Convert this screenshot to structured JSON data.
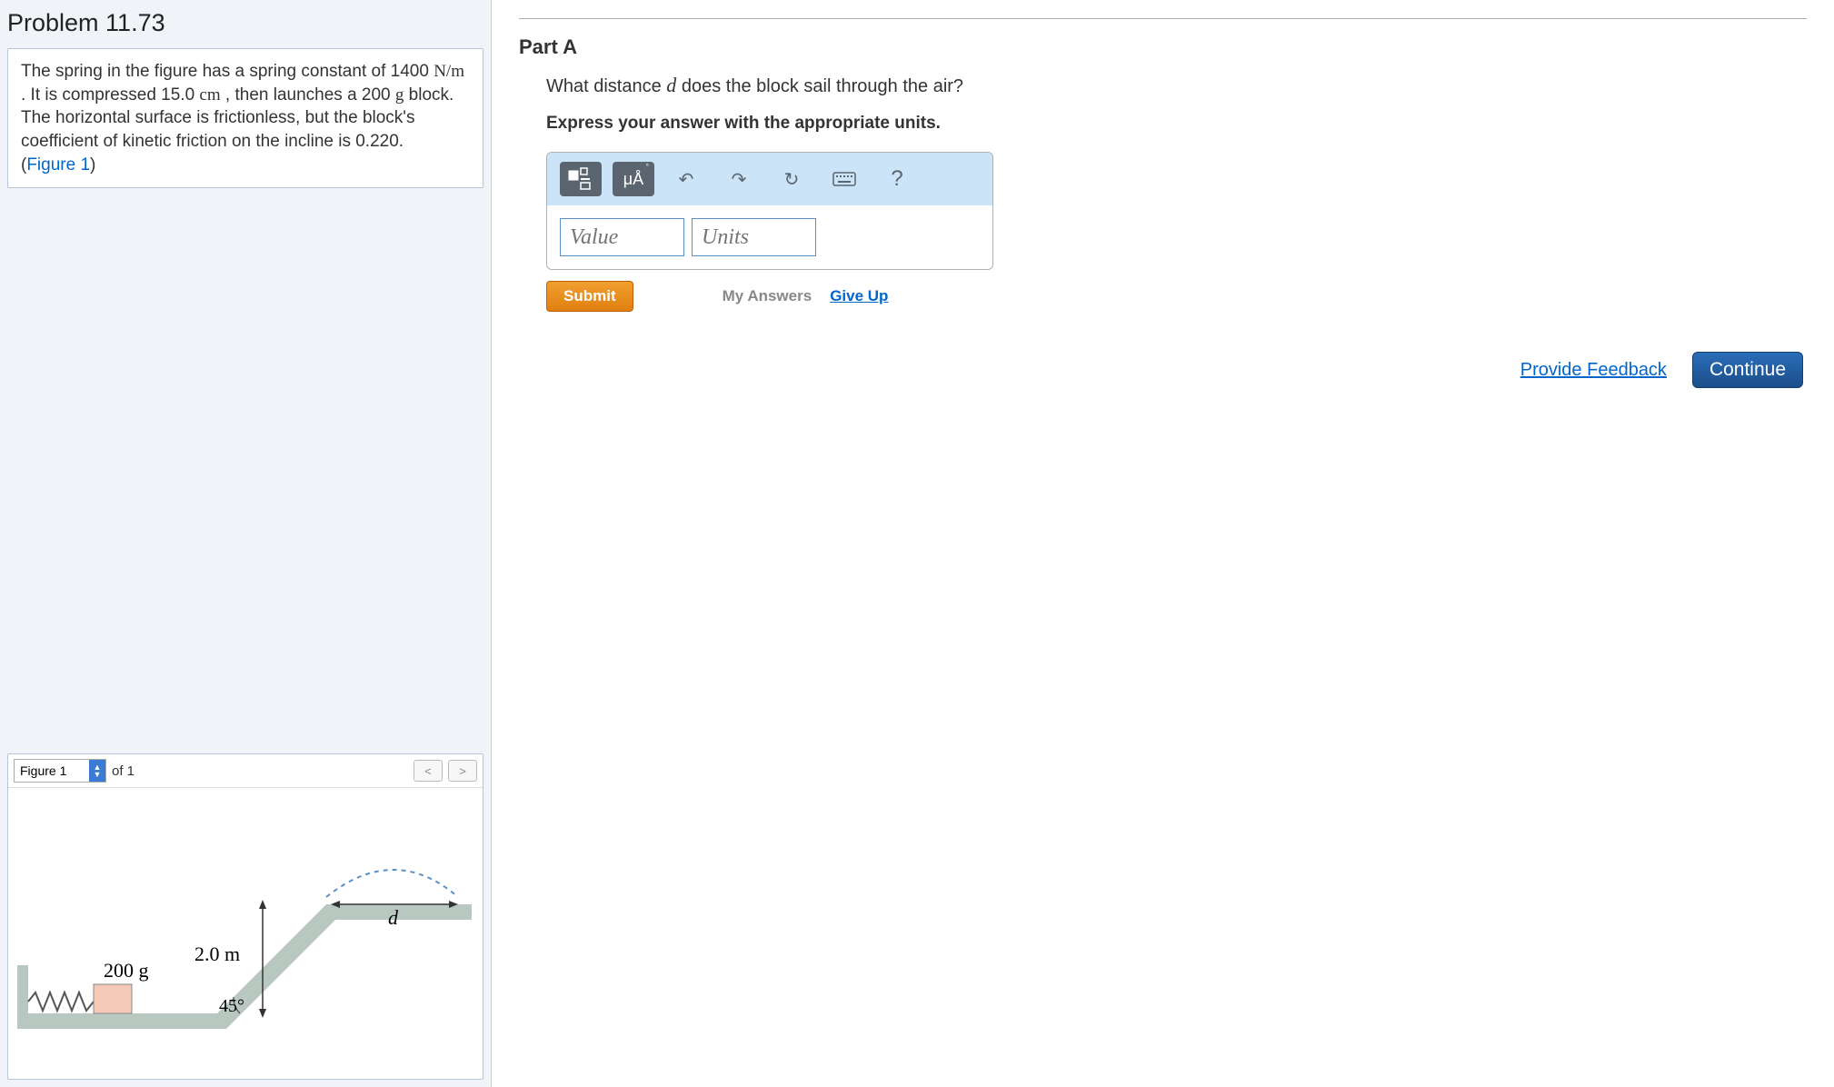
{
  "problem": {
    "title": "Problem 11.73",
    "text_1": "The spring in the figure has a spring constant of 1400 ",
    "unit_nm": "N/m",
    "text_2": " . It is compressed 15.0 ",
    "unit_cm": "cm",
    "text_3": " , then launches a 200 ",
    "unit_g": "g",
    "text_4": " block. The horizontal surface is frictionless, but the block's coefficient of kinetic friction on the incline is 0.220.",
    "figure_link": "Figure 1"
  },
  "figure": {
    "select_value": "Figure 1",
    "of_text": "of 1",
    "mass": "200 g",
    "height": "2.0 m",
    "angle": "45°",
    "d_label": "d"
  },
  "part": {
    "label": "Part A",
    "question_pre": "What distance ",
    "question_var": "d",
    "question_post": " does the block sail through the air?",
    "instruction": "Express your answer with the appropriate units.",
    "units_btn": "μÅ",
    "value_placeholder": "Value",
    "units_placeholder": "Units",
    "submit": "Submit",
    "my_answers": "My Answers",
    "give_up": "Give Up"
  },
  "footer": {
    "feedback": "Provide Feedback",
    "continue": "Continue"
  }
}
